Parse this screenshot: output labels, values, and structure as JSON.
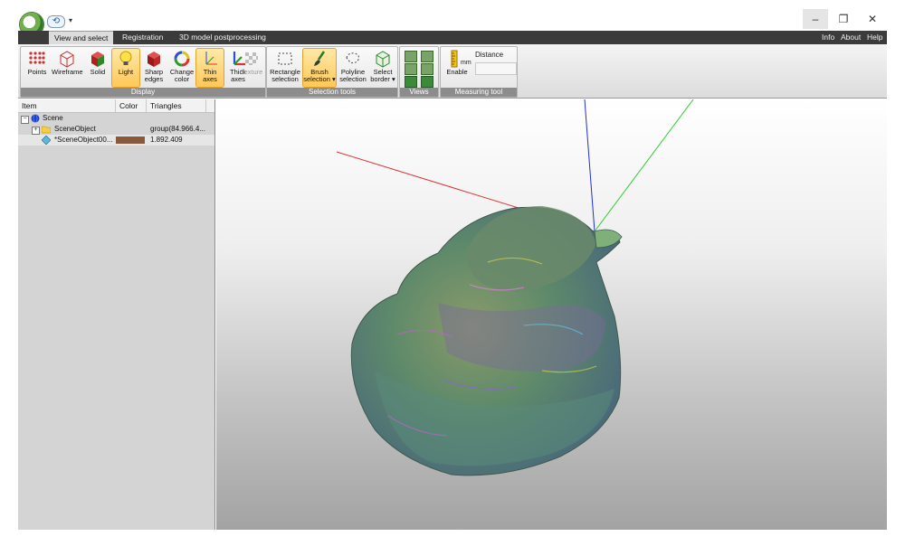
{
  "quick_access": {
    "undo_glyph": "⟲",
    "customize_glyph": "▾"
  },
  "window_controls": {
    "minimize": "–",
    "maximize": "❐",
    "close": "✕"
  },
  "tabs": [
    {
      "label": "View and select",
      "active": true
    },
    {
      "label": "Registration",
      "active": false
    },
    {
      "label": "3D model postprocessing",
      "active": false
    }
  ],
  "help_menu": {
    "info": "Info",
    "about": "About",
    "help": "Help"
  },
  "ribbon": {
    "display": {
      "label": "Display",
      "tools": [
        {
          "label": "Points",
          "icon": "points-icon",
          "active": false
        },
        {
          "label": "Wireframe",
          "icon": "wireframe-icon",
          "active": false
        },
        {
          "label": "Solid",
          "icon": "solid-cube-icon",
          "active": false
        },
        {
          "label": "Light",
          "icon": "light-bulb-icon",
          "active": true
        },
        {
          "label": "Sharp edges",
          "icon": "sharp-edges-icon",
          "active": false
        },
        {
          "label": "Change color",
          "icon": "color-ring-icon",
          "active": false
        },
        {
          "label": "Thin axes",
          "icon": "thin-axes-icon",
          "active": true
        },
        {
          "label": "Thick axes",
          "icon": "thick-axes-icon",
          "active": false
        },
        {
          "label": "Texture",
          "icon": "texture-icon",
          "active": false,
          "disabled": true
        }
      ]
    },
    "selection": {
      "label": "Selection tools",
      "tools": [
        {
          "label": "Rectangle selection",
          "icon": "rectangle-selection-icon",
          "active": false
        },
        {
          "label": "Brush selection ▾",
          "icon": "brush-icon",
          "active": true
        },
        {
          "label": "Polyline selection",
          "icon": "polyline-icon",
          "active": false
        },
        {
          "label": "Select border ▾",
          "icon": "select-border-icon",
          "active": false
        }
      ]
    },
    "views": {
      "label": "Views"
    },
    "measuring": {
      "label": "Measuring tool",
      "enable_label": "Enable",
      "unit": "mm",
      "distance_label": "Distance",
      "distance_value": ""
    }
  },
  "tree": {
    "columns": [
      "Item",
      "Color",
      "Triangles"
    ],
    "rows": [
      {
        "name": "Scene",
        "color": "",
        "triangles": "",
        "level": 0,
        "expander": "−",
        "icon": "scene-globe-icon"
      },
      {
        "name": "SceneObject",
        "color": "",
        "triangles": "group(84.966.4...",
        "level": 1,
        "expander": "+",
        "icon": "folder-icon"
      },
      {
        "name": "*SceneObject00...",
        "color": "#8b5a3c",
        "triangles": "1.892.409",
        "level": 1,
        "expander": "",
        "icon": "mesh-object-icon"
      }
    ]
  },
  "axes_colors": {
    "x": "#e03030",
    "y": "#33cc33",
    "z": "#2030d0"
  }
}
